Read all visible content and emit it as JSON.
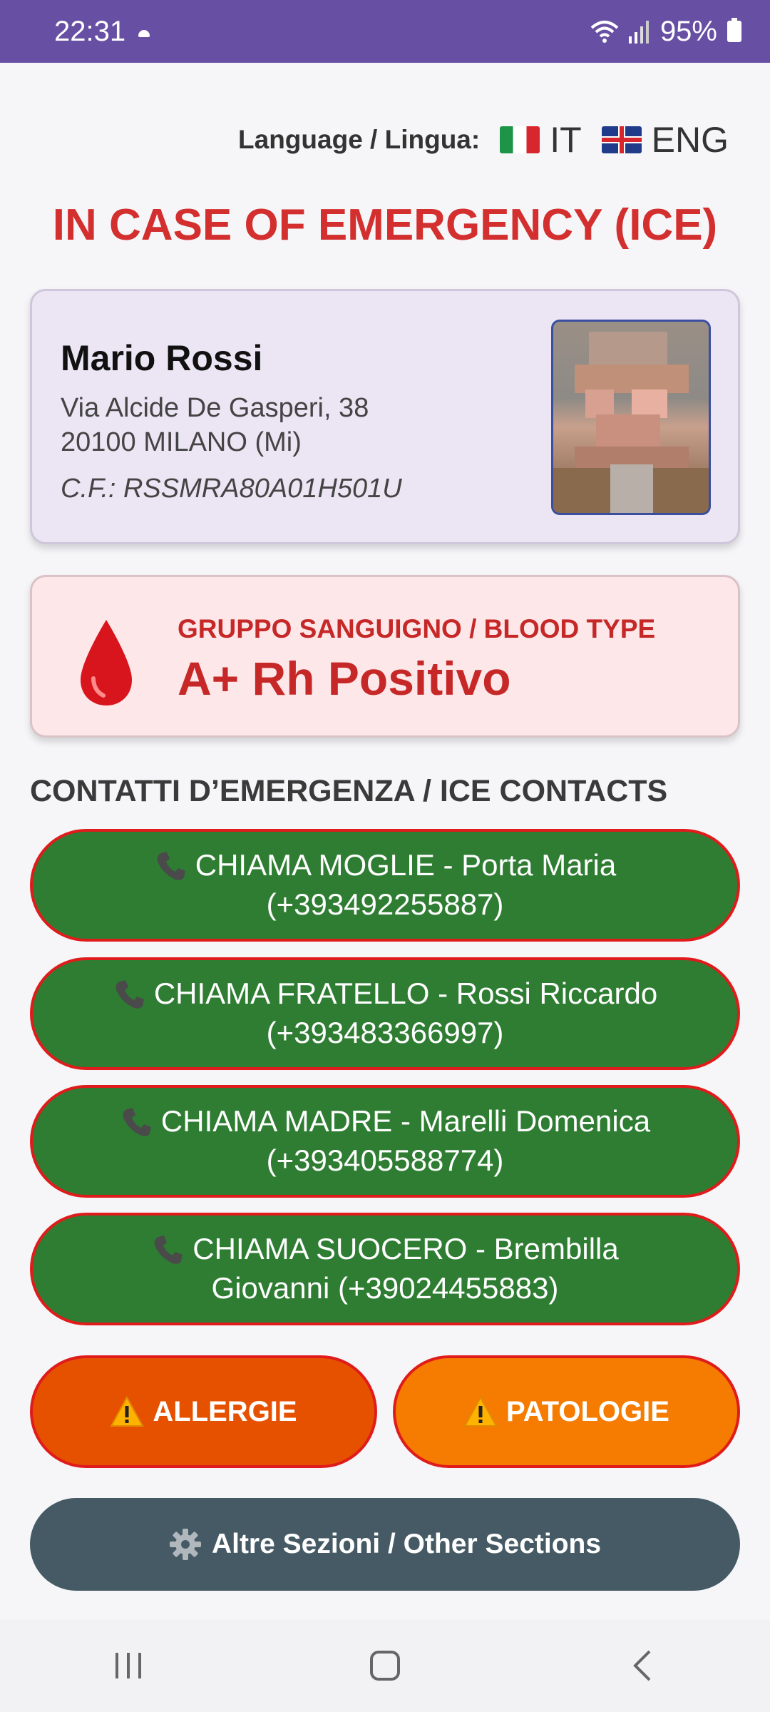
{
  "status_bar": {
    "time": "22:31",
    "battery": "95%",
    "icons": [
      "cloud-icon",
      "wifi-icon",
      "signal-icon",
      "battery-icon"
    ]
  },
  "language": {
    "label": "Language / Lingua:",
    "options": [
      {
        "code": "IT",
        "icon": "italy-flag-icon"
      },
      {
        "code": "ENG",
        "icon": "uk-flag-icon"
      }
    ]
  },
  "title": "IN CASE OF EMERGENCY (ICE)",
  "profile": {
    "name": "Mario Rossi",
    "address_line1": "Via Alcide De Gasperi, 38",
    "address_line2": "20100 MILANO (Mi)",
    "fiscal_code": "C.F.: RSSMRA80A01H501U"
  },
  "blood": {
    "label": "GRUPPO SANGUIGNO / BLOOD TYPE",
    "value": "A+ Rh Positivo",
    "icon": "blood-drop-icon"
  },
  "contacts": {
    "title": "CONTATTI D’EMERGENZA / ICE CONTACTS",
    "items": [
      {
        "line1": "CHIAMA MOGLIE - Porta Maria",
        "line2": "(+393492255887)"
      },
      {
        "line1": "CHIAMA FRATELLO - Rossi Riccardo",
        "line2": "(+393483366997)"
      },
      {
        "line1": "CHIAMA MADRE - Marelli Domenica",
        "line2": "(+393405588774)"
      },
      {
        "line1": "CHIAMA SUOCERO - Brembilla",
        "line2": "Giovanni (+39024455883)"
      }
    ]
  },
  "buttons": {
    "allergie": "ALLERGIE",
    "patologie": "PATOLOGIE",
    "other_sections": "Altre Sezioni / Other Sections"
  },
  "colors": {
    "status_bar": "#6750a4",
    "title_red": "#d32f2f",
    "call_green": "#2e7d32",
    "call_border": "#e01b1b",
    "allergie": "#e65100",
    "patologie": "#f57c00",
    "other": "#455a64"
  }
}
